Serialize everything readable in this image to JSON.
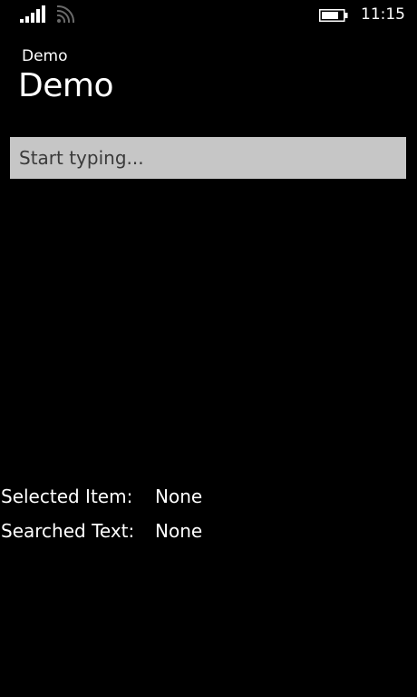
{
  "status_bar": {
    "signal_icon": "signal-strength-icon",
    "wifi_icon": "wifi-icon",
    "battery_icon": "battery-icon",
    "battery_level_percent": 80,
    "time": "11:15"
  },
  "header": {
    "app_name": "Demo",
    "page_title": "Demo"
  },
  "search": {
    "value": "",
    "placeholder": "Start typing..."
  },
  "results": {
    "selected_item_label": "Selected Item:",
    "selected_item_value": "None",
    "searched_text_label": "Searched Text:",
    "searched_text_value": "None"
  },
  "colors": {
    "background": "#000000",
    "foreground": "#ffffff",
    "textbox_background": "#c6c6c6"
  }
}
